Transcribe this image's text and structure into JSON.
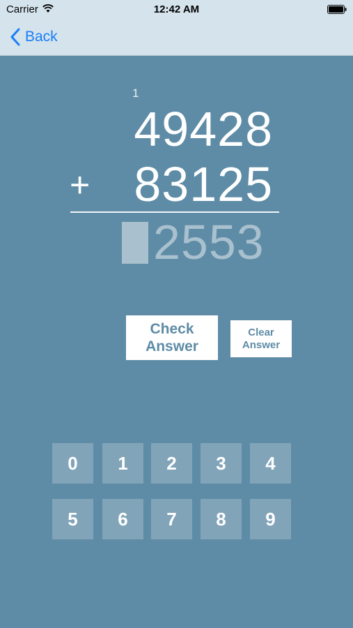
{
  "status_bar": {
    "carrier": "Carrier",
    "time": "12:42 AM"
  },
  "nav": {
    "back_label": "Back"
  },
  "problem": {
    "carry": "1",
    "addend_1": "49428",
    "addend_2": "83125",
    "operator": "+",
    "answer_entered": "2553"
  },
  "actions": {
    "check_line1": "Check",
    "check_line2": "Answer",
    "clear_line1": "Clear",
    "clear_line2": "Answer"
  },
  "keypad": {
    "keys": [
      "0",
      "1",
      "2",
      "3",
      "4",
      "5",
      "6",
      "7",
      "8",
      "9"
    ]
  },
  "colors": {
    "background": "#5e8ca6",
    "nav_background": "#d4e3ec",
    "link_blue": "#1a7ef7",
    "key_background": "#81a4b9",
    "answer_faded": "#a9c0ce"
  }
}
